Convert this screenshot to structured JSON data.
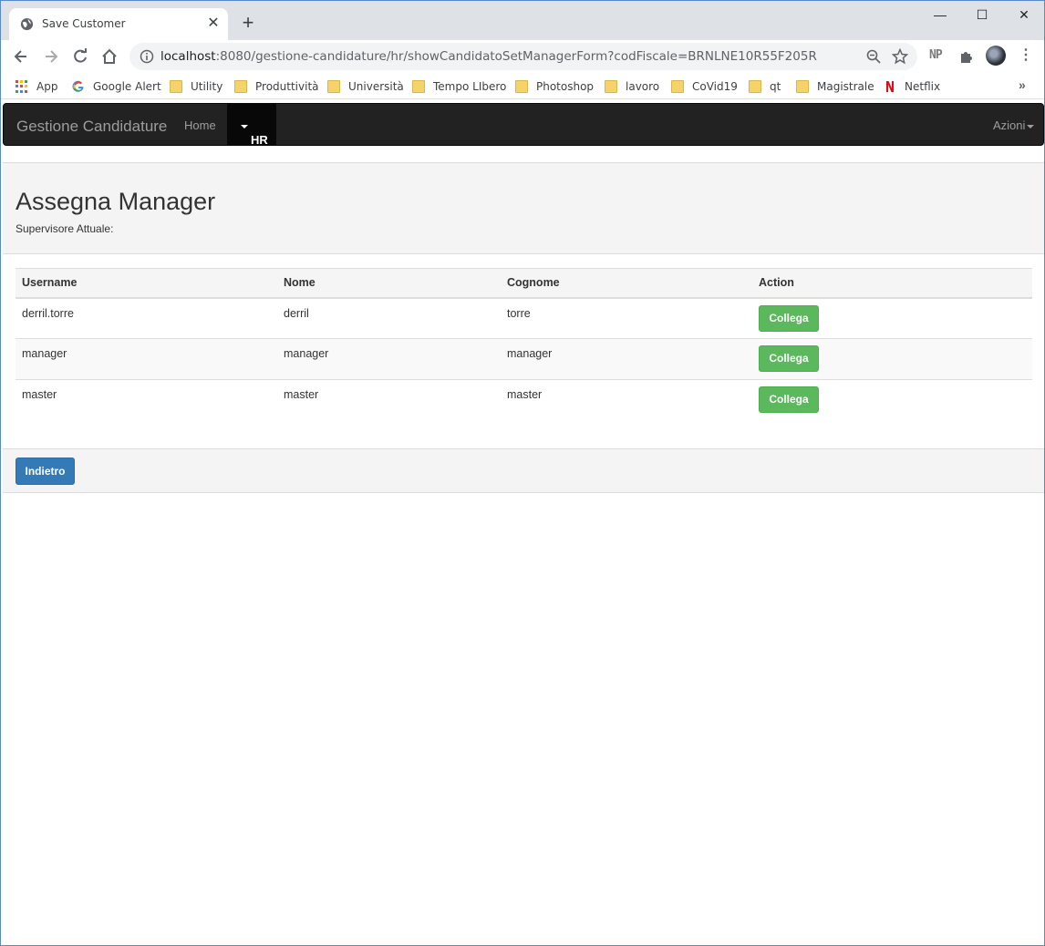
{
  "browser": {
    "tab_title": "Save Customer",
    "url_host": "localhost",
    "url_rest": ":8080/gestione-candidature/hr/showCandidatoSetManagerForm?codFiscale=BRNLNE10R55F205R",
    "extension_label": "NP",
    "bookmarks": [
      {
        "label": "App",
        "icon": "apps-grid-icon"
      },
      {
        "label": "Google Alert",
        "icon": "google-icon"
      },
      {
        "label": "Utility",
        "icon": "folder-icon"
      },
      {
        "label": "Produttività",
        "icon": "folder-icon"
      },
      {
        "label": "Università",
        "icon": "folder-icon"
      },
      {
        "label": "Tempo LIbero",
        "icon": "folder-icon"
      },
      {
        "label": "Photoshop",
        "icon": "folder-icon"
      },
      {
        "label": "lavoro",
        "icon": "folder-icon"
      },
      {
        "label": "CoVid19",
        "icon": "folder-icon"
      },
      {
        "label": "qt",
        "icon": "folder-icon"
      },
      {
        "label": "Magistrale",
        "icon": "folder-icon"
      },
      {
        "label": "Netflix",
        "icon": "netflix-icon"
      }
    ]
  },
  "navbar": {
    "brand": "Gestione Candidature",
    "home": "Home",
    "hr": "HR",
    "azioni": "Azioni"
  },
  "header": {
    "title": "Assegna Manager",
    "subtitle": "Supervisore Attuale:"
  },
  "table": {
    "columns": [
      "Username",
      "Nome",
      "Cognome",
      "Action"
    ],
    "rows": [
      {
        "username": "derril.torre",
        "nome": "derril",
        "cognome": "torre",
        "action": "Collega"
      },
      {
        "username": "manager",
        "nome": "manager",
        "cognome": "manager",
        "action": "Collega"
      },
      {
        "username": "master",
        "nome": "master",
        "cognome": "master",
        "action": "Collega"
      }
    ]
  },
  "footer": {
    "back_label": "Indietro"
  },
  "colors": {
    "navbar_bg": "#222222",
    "success": "#5cb85c",
    "primary": "#337ab7",
    "panel_bg": "#f4f4f4"
  }
}
